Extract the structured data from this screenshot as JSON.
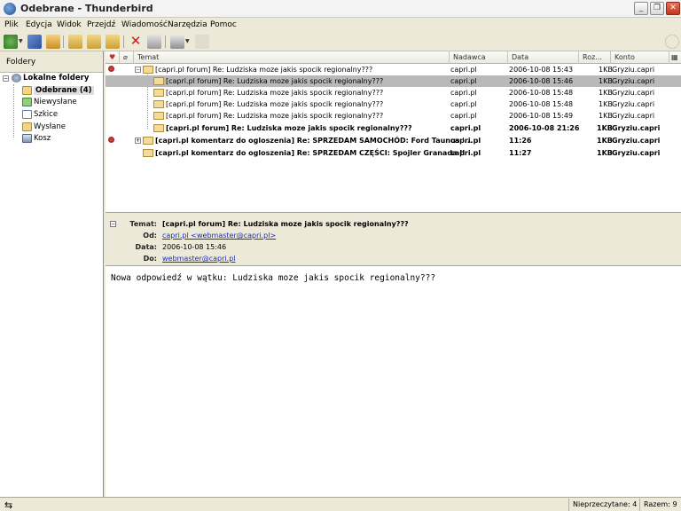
{
  "window": {
    "title": "Odebrane - Thunderbird"
  },
  "menu": [
    "Plik",
    "Edycja",
    "Widok",
    "Przejdź",
    "Wiadomość",
    "Narzędzia",
    "Pomoc"
  ],
  "folders": {
    "header": "Foldery",
    "account": "Lokalne foldery",
    "items": [
      {
        "label": "Odebrane (4)",
        "icon": "inbox-icon",
        "selected": true
      },
      {
        "label": "Niewysłane",
        "icon": "outbox-icon"
      },
      {
        "label": "Szkice",
        "icon": "drafts-icon"
      },
      {
        "label": "Wysłane",
        "icon": "sent-icon"
      },
      {
        "label": "Kosz",
        "icon": "trash-icon"
      }
    ]
  },
  "columns": {
    "subject": "Temat",
    "sender": "Nadawca",
    "date": "Data",
    "size": "Roz...",
    "account": "Konto"
  },
  "messages": [
    {
      "subject": "[capri.pl forum] Re: Ludziska moze jakis spocik regionalny???",
      "sender": "capri.pl",
      "date": "2006-10-08 15:43",
      "size": "1KB",
      "account": "Gryziu.capri"
    },
    {
      "subject": "[capri.pl forum] Re: Ludziska moze jakis spocik regionalny???",
      "sender": "capri.pl",
      "date": "2006-10-08 15:46",
      "size": "1KB",
      "account": "Gryziu.capri"
    },
    {
      "subject": "[capri.pl forum] Re: Ludziska moze jakis spocik regionalny???",
      "sender": "capri.pl",
      "date": "2006-10-08 15:48",
      "size": "1KB",
      "account": "Gryziu.capri"
    },
    {
      "subject": "[capri.pl forum] Re: Ludziska moze jakis spocik regionalny???",
      "sender": "capri.pl",
      "date": "2006-10-08 15:48",
      "size": "1KB",
      "account": "Gryziu.capri"
    },
    {
      "subject": "[capri.pl forum] Re: Ludziska moze jakis spocik regionalny???",
      "sender": "capri.pl",
      "date": "2006-10-08 15:49",
      "size": "1KB",
      "account": "Gryziu.capri"
    },
    {
      "subject": "[capri.pl forum] Re: Ludziska moze jakis spocik regionalny???",
      "sender": "capri.pl",
      "date": "2006-10-08 21:26",
      "size": "1KB",
      "account": "Gryziu.capri"
    },
    {
      "subject": "[capri.pl komentarz do ogloszenia] Re: SPRZEDAM SAMOCHÓD: Ford Taunus '...",
      "sender": "capri.pl",
      "date": "11:26",
      "size": "1KB",
      "account": "Gryziu.capri"
    },
    {
      "subject": "[capri.pl komentarz do ogloszenia] Re: SPRZEDAM CZĘŚCI: Spojler Granada II",
      "sender": "capri.pl",
      "date": "11:27",
      "size": "1KB",
      "account": "Gryziu.capri"
    }
  ],
  "header": {
    "subject_label": "Temat:",
    "subject": "[capri.pl forum] Re: Ludziska moze jakis spocik regionalny???",
    "from_label": "Od:",
    "from": "capri.pl <webmaster@capri.pl>",
    "date_label": "Data:",
    "date": "2006-10-08 15:46",
    "to_label": "Do:",
    "to": "webmaster@capri.pl"
  },
  "body": "Nowa odpowiedź w wątku: Ludziska moze jakis spocik regionalny???",
  "status": {
    "unread": "Nieprzeczytane: 4",
    "total": "Razem: 9"
  },
  "colors": {
    "selection": "#b9b9b9",
    "link": "#1a2fbf",
    "chrome": "#ece9d8"
  }
}
